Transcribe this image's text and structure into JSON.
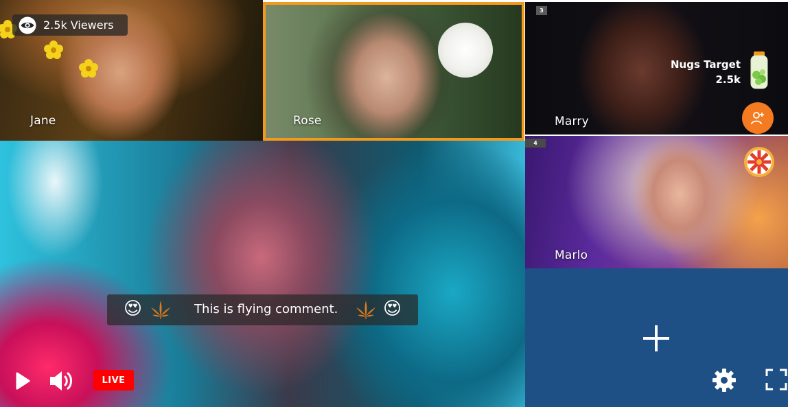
{
  "viewers": {
    "count_label": "2.5k Viewers"
  },
  "tiles": {
    "jane": {
      "name": "Jane"
    },
    "rose": {
      "name": "Rose"
    },
    "marry": {
      "name": "Marry",
      "slot": "3"
    },
    "marlo": {
      "name": "Marlo",
      "slot": "4"
    }
  },
  "nugs": {
    "title": "Nugs Target",
    "value": "2.5k"
  },
  "comment": {
    "text": "This is flying comment.",
    "emoji_left": "😍",
    "emoji_right": "😍"
  },
  "controls": {
    "live_label": "LIVE"
  },
  "colors": {
    "accent_orange": "#f19a1d",
    "add_friend_orange": "#f47b20",
    "live_red": "#ff0000",
    "add_tile_blue": "#1e4f85"
  },
  "icons": {
    "viewers": "eye-icon",
    "nugs": "jar-icon",
    "add_friend": "add-user-icon",
    "wheel": "spin-wheel-icon",
    "play": "play-icon",
    "volume": "volume-icon",
    "add": "plus-icon",
    "settings": "gear-icon",
    "fullscreen": "fullscreen-icon",
    "cannabis": "cannabis-leaf-icon"
  }
}
